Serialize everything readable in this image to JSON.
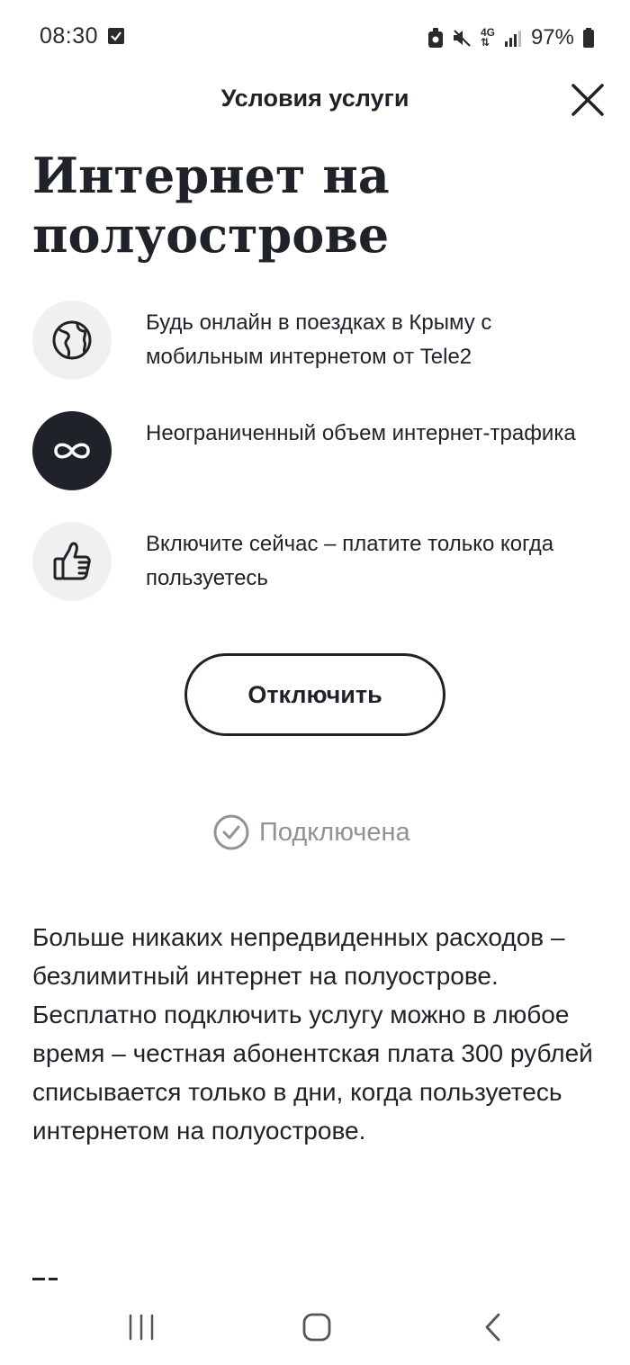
{
  "status_bar": {
    "time": "08:30",
    "network": "4G",
    "battery": "97%"
  },
  "header": {
    "title": "Условия услуги"
  },
  "page": {
    "title": "Интернет на полуострове"
  },
  "features": [
    {
      "icon": "globe-icon",
      "text": "Будь онлайн в поездках в Крыму с мобильным интернетом от Tele2"
    },
    {
      "icon": "infinity-icon",
      "text": "Неограниченный объем интернет-трафика"
    },
    {
      "icon": "thumbs-up-icon",
      "text": "Включите сейчас – платите только когда пользуетесь"
    }
  ],
  "action": {
    "label": "Отключить"
  },
  "service_status": {
    "label": "Подключена"
  },
  "description": "Больше никаких непредвиденных расходов – безлимитный интернет на полуострове. Бесплатно подключить услугу можно в любое время – честная абонентская плата 300 рублей списывается только в дни, когда пользуетесь интернетом на полуострове.",
  "colors": {
    "text": "#1f2229",
    "icon_bg": "#f0f0f0",
    "icon_bg_dark": "#1f2229",
    "muted": "#8f9296"
  }
}
